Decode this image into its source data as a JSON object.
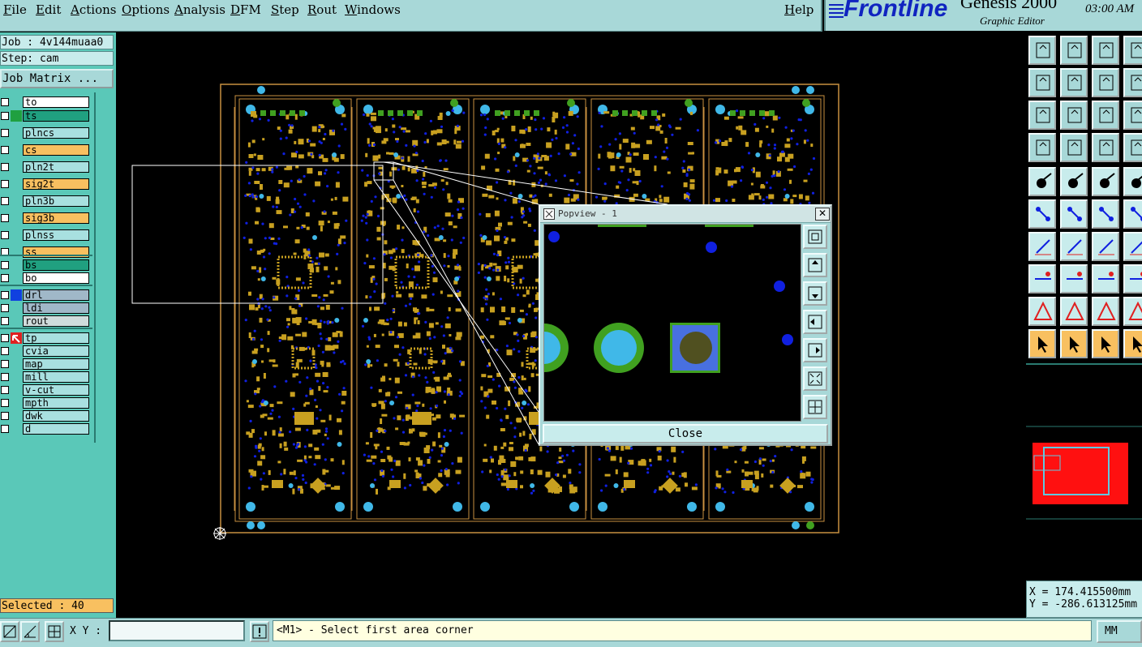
{
  "menubar": {
    "items": [
      {
        "label": "File"
      },
      {
        "label": "Edit"
      },
      {
        "label": "Actions"
      },
      {
        "label": "Options"
      },
      {
        "label": "Analysis"
      },
      {
        "label": "DFM"
      },
      {
        "label": "Step"
      },
      {
        "label": "Rout"
      },
      {
        "label": "Windows"
      }
    ],
    "help": "Help"
  },
  "brand": {
    "logo": "Frontline",
    "product": "Genesis 2000",
    "subtitle": "Graphic Editor",
    "time": "03:00 AM"
  },
  "job": {
    "job_label": "Job : 4v144muaa0",
    "step_label": "Step: cam",
    "matrix_button": "Job Matrix ..."
  },
  "layers": [
    {
      "name": "to",
      "color": "#ffffff",
      "swatch": ""
    },
    {
      "name": "ts",
      "color": "#20a080",
      "swatch": "#20a040"
    },
    {
      "name": "plncs",
      "color": "#a8e0e0",
      "swatch": ""
    },
    {
      "name": "cs",
      "color": "#f8c060",
      "swatch": ""
    },
    {
      "name": "pln2t",
      "color": "#a8e0e0",
      "swatch": ""
    },
    {
      "name": "sig2t",
      "color": "#f8c060",
      "swatch": ""
    },
    {
      "name": "pln3b",
      "color": "#a8e0e0",
      "swatch": ""
    },
    {
      "name": "sig3b",
      "color": "#f8c060",
      "swatch": ""
    },
    {
      "name": "plnss",
      "color": "#a8e0e0",
      "swatch": ""
    },
    {
      "name": "ss",
      "color": "#f8c060",
      "swatch": ""
    },
    {
      "name": "bs",
      "color": "#20a080",
      "swatch": ""
    },
    {
      "name": "bo",
      "color": "#ffffff",
      "swatch": ""
    },
    {
      "name": "drl",
      "color": "#a0b8c8",
      "swatch": "#1040e0"
    },
    {
      "name": "ldi",
      "color": "#a0b8c8",
      "swatch": ""
    },
    {
      "name": "rout",
      "color": "#d0dcdc",
      "swatch": ""
    },
    {
      "name": "tp",
      "color": "#a8e0e0",
      "swatch": "#e02020"
    },
    {
      "name": "cvia",
      "color": "#a8e0e0",
      "swatch": ""
    },
    {
      "name": "map",
      "color": "#a8e0e0",
      "swatch": ""
    },
    {
      "name": "mill",
      "color": "#a8e0e0",
      "swatch": ""
    },
    {
      "name": "v-cut",
      "color": "#a8e0e0",
      "swatch": ""
    },
    {
      "name": "mpth",
      "color": "#a8e0e0",
      "swatch": ""
    },
    {
      "name": "dwk",
      "color": "#a8e0e0",
      "swatch": ""
    },
    {
      "name": "d",
      "color": "#a8e0e0",
      "swatch": ""
    }
  ],
  "status": {
    "selected": "Selected : 40",
    "xy_label": "X Y :",
    "xy_value": "",
    "message": "<M1> - Select first area corner",
    "units": "MM"
  },
  "coords": {
    "x": "X = 174.415500mm",
    "y": "Y = -286.613125mm"
  },
  "popview": {
    "title": "Popview - 1",
    "close_label": "Close"
  },
  "colors": {
    "copper": "#c8a020",
    "pad_cyan": "#40b8e8",
    "pad_green": "#40a020",
    "via_blue": "#1020e0",
    "outline": "#c89040"
  }
}
